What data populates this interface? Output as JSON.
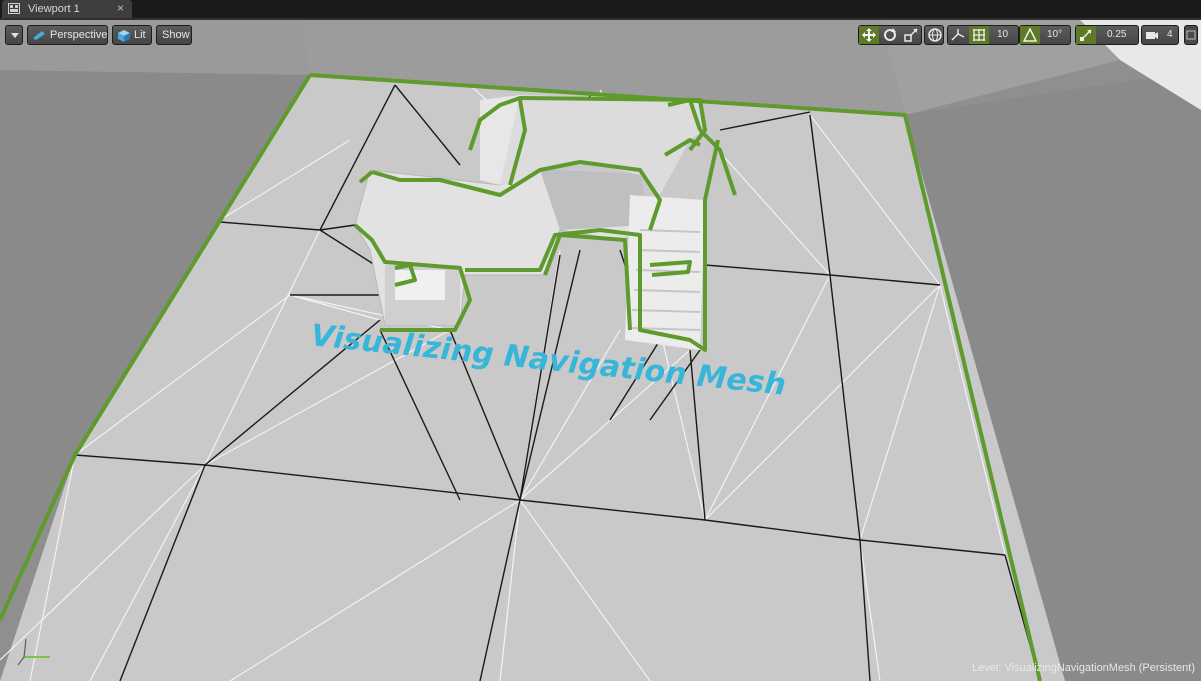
{
  "tab": {
    "title": "Viewport 1",
    "close_glyph": "×",
    "icon": "viewport-icon"
  },
  "toolbar": {
    "view_mode_label": "Perspective",
    "lit_label": "Lit",
    "show_label": "Show",
    "grid_snap_value": "10",
    "rotation_snap_value": "10°",
    "scale_snap_value": "0.25",
    "camera_speed_value": "4"
  },
  "scene": {
    "overlay_text": "Visualizing Navigation Mesh",
    "navmesh_color": "#5f9a2c",
    "overlay_text_color": "#38b6d9"
  },
  "status": {
    "level_prefix": "Level:",
    "level_name": "VisualizingNavigationMesh (Persistent)"
  }
}
